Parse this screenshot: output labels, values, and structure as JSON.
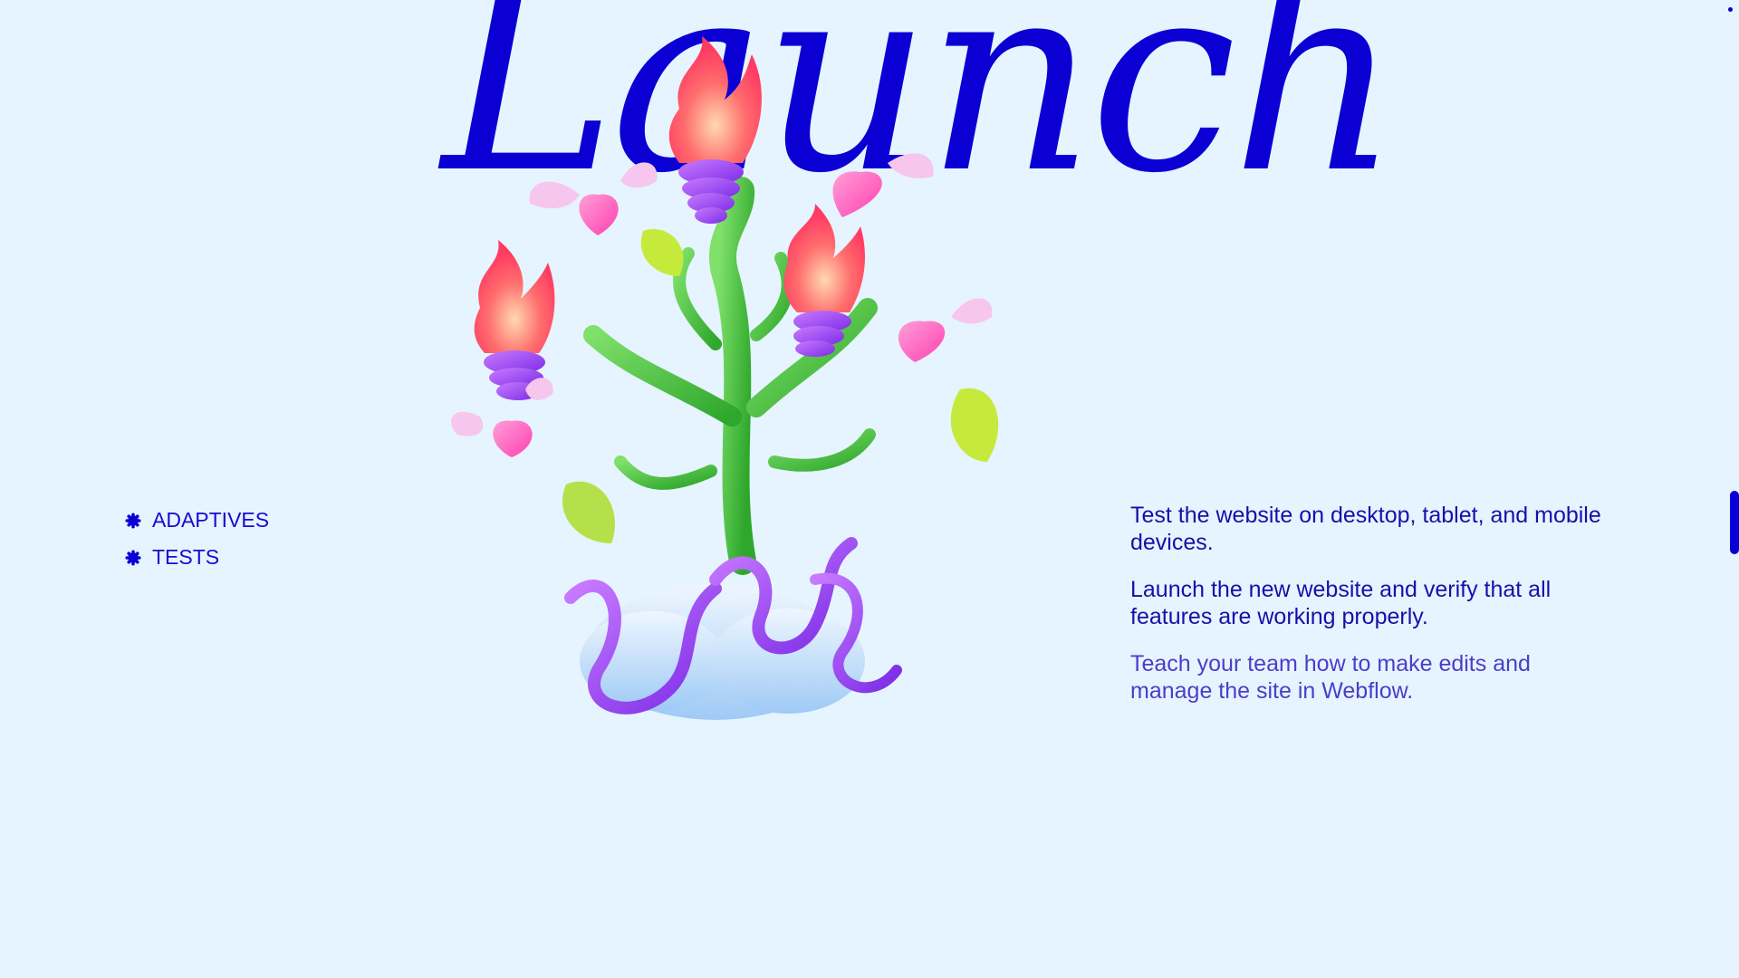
{
  "hero": {
    "title": "Launch"
  },
  "left_list": [
    {
      "label": "ADAPTIVES",
      "icon": "asterisk-bullet-icon"
    },
    {
      "label": "TESTS",
      "icon": "asterisk-bullet-icon"
    }
  ],
  "right_copy": {
    "p1": "Test the website on desktop, tablet, and mobile devices.",
    "p2": "Launch the new website and verify that all features are working properly.",
    "p3": "Teach your team how to make edits and manage the site in Webflow."
  },
  "colors": {
    "background": "#e6f4ff",
    "accent": "#0b00d4",
    "text": "#180fa9"
  }
}
